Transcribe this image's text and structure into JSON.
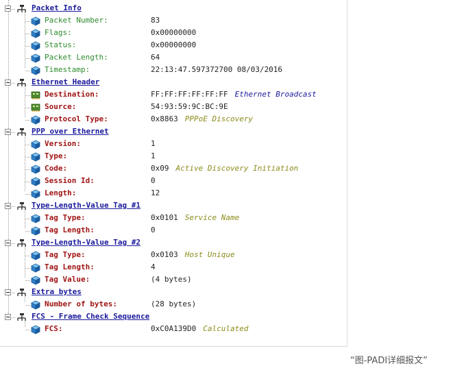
{
  "groups": [
    {
      "label": "Packet Info",
      "fields": [
        {
          "label": "Packet Number:",
          "value": "83",
          "desc": "",
          "style": "green",
          "icon": "cube"
        },
        {
          "label": "Flags:",
          "value": "0x00000000",
          "desc": "",
          "style": "green",
          "icon": "cube"
        },
        {
          "label": "Status:",
          "value": "0x00000000",
          "desc": "",
          "style": "green",
          "icon": "cube"
        },
        {
          "label": "Packet Length:",
          "value": "64",
          "desc": "",
          "style": "green",
          "icon": "cube"
        },
        {
          "label": "Timestamp:",
          "value": "22:13:47.597372700 08/03/2016",
          "desc": "",
          "style": "green",
          "icon": "cube"
        }
      ]
    },
    {
      "label": "Ethernet Header",
      "fields": [
        {
          "label": "Destination:",
          "value": "FF:FF:FF:FF:FF:FF",
          "desc": "Ethernet Broadcast",
          "descColor": "blue",
          "style": "red",
          "icon": "network"
        },
        {
          "label": "Source:",
          "value": "54:93:59:9C:BC:9E",
          "desc": "",
          "style": "red",
          "icon": "network"
        },
        {
          "label": "Protocol Type:",
          "value": "0x8863",
          "desc": "PPPoE Discovery",
          "descColor": "olive",
          "style": "red",
          "icon": "cube"
        }
      ]
    },
    {
      "label": "PPP over Ethernet",
      "fields": [
        {
          "label": "Version:",
          "value": "1",
          "desc": "",
          "style": "red",
          "icon": "cube"
        },
        {
          "label": "Type:",
          "value": "1",
          "desc": "",
          "style": "red",
          "icon": "cube"
        },
        {
          "label": "Code:",
          "value": "0x09",
          "desc": "Active Discovery Initiation",
          "descColor": "olive",
          "style": "red",
          "icon": "cube"
        },
        {
          "label": "Session Id:",
          "value": "0",
          "desc": "",
          "style": "red",
          "icon": "cube"
        },
        {
          "label": "Length:",
          "value": "12",
          "desc": "",
          "style": "red",
          "icon": "cube"
        }
      ]
    },
    {
      "label": "Type-Length-Value Tag #1",
      "fields": [
        {
          "label": "Tag Type:",
          "value": "0x0101",
          "desc": "Service Name",
          "descColor": "olive",
          "style": "red",
          "icon": "cube"
        },
        {
          "label": "Tag Length:",
          "value": "0",
          "desc": "",
          "style": "red",
          "icon": "cube"
        }
      ]
    },
    {
      "label": "Type-Length-Value Tag #2",
      "fields": [
        {
          "label": "Tag Type:",
          "value": "0x0103",
          "desc": "Host Unique",
          "descColor": "olive",
          "style": "red",
          "icon": "cube"
        },
        {
          "label": "Tag Length:",
          "value": "4",
          "desc": "",
          "style": "red",
          "icon": "cube"
        },
        {
          "label": "Tag Value:",
          "value": "(4 bytes)",
          "desc": "",
          "style": "red",
          "icon": "cube"
        }
      ]
    },
    {
      "label": "Extra bytes",
      "fields": [
        {
          "label": "Number of bytes:",
          "value": "(28 bytes)",
          "desc": "",
          "style": "red",
          "icon": "cube"
        }
      ]
    },
    {
      "label": "FCS - Frame Check Sequence",
      "fields": [
        {
          "label": "FCS:",
          "value": "0xC0A139D0",
          "desc": "Calculated",
          "descColor": "olive",
          "style": "red",
          "icon": "cube"
        }
      ]
    }
  ],
  "caption": "“图-PADI详细报文”",
  "colors": {
    "group_label": "#1a1a9c",
    "field_green": "#2e8b2e",
    "field_red": "#a01414",
    "desc_olive": "#8b8b1a",
    "desc_blue": "#1a1a9c"
  },
  "icons": {
    "group": "group-tree-icon",
    "field": "cube-icon",
    "address": "network-card-icon"
  }
}
